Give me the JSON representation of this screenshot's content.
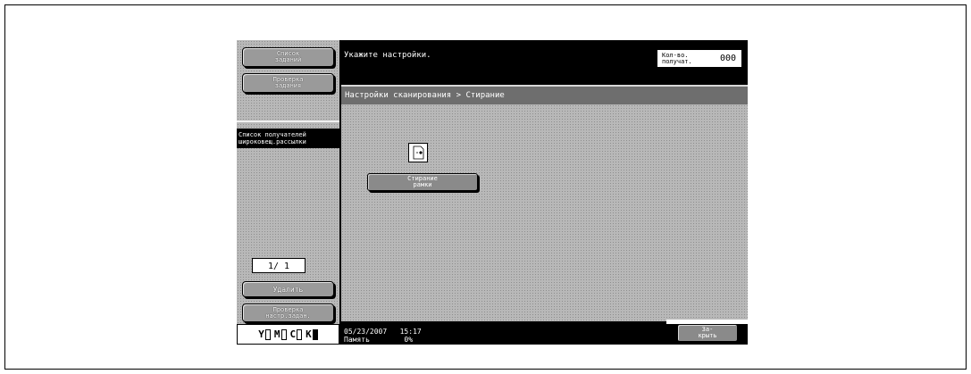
{
  "left_panel": {
    "job_list_label": "Список\nзаданий",
    "job_check_label": "Проверка\nзадания",
    "broadcast_label": "Список получателей\nшироковещ.рассылки",
    "page_indicator": "1/  1",
    "delete_label": "Удалить",
    "check_settings_label": "Проверка\nнастр.задан.",
    "toner": [
      {
        "letter": "Y",
        "level": 0
      },
      {
        "letter": "M",
        "level": 0
      },
      {
        "letter": "C",
        "level": 0
      },
      {
        "letter": "K",
        "level": 1
      }
    ]
  },
  "header": {
    "message": "Укажите настройки.",
    "count_label": "Кол-во.\nполучат.",
    "count_value": "000"
  },
  "breadcrumb": "Настройки сканирования > Стирание",
  "main": {
    "erase_button_label": "Стирание\nрамки",
    "erase_icon": "frame-erase-icon"
  },
  "status": {
    "datetime": "05/23/2007   15:17",
    "memory": "Память        0%"
  },
  "close_button_label": "За-\nкрыть"
}
